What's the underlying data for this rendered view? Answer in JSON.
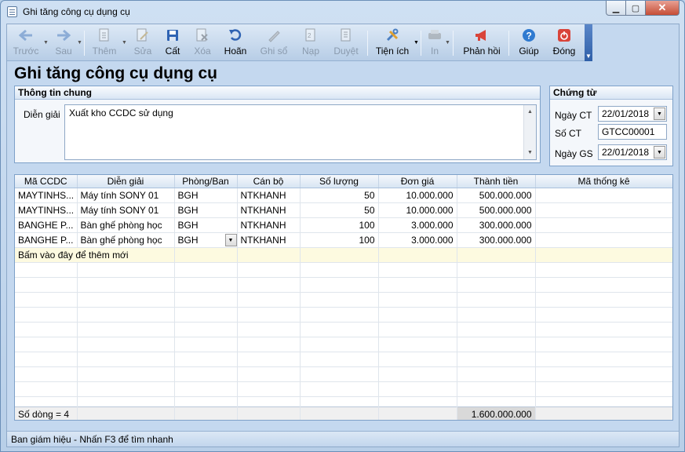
{
  "window": {
    "title": "Ghi tăng công cụ dụng cụ"
  },
  "toolbar": {
    "back": "Trước",
    "next": "Sau",
    "add": "Thêm",
    "edit": "Sửa",
    "save": "Cất",
    "delete": "Xóa",
    "undo": "Hoãn",
    "post": "Ghi sổ",
    "load": "Nạp",
    "approve": "Duyệt",
    "utilities": "Tiện ích",
    "print": "In",
    "feedback": "Phản hồi",
    "help": "Giúp",
    "close": "Đóng"
  },
  "page_title": "Ghi tăng công cụ dụng cụ",
  "general_info": {
    "header": "Thông tin chung",
    "desc_label": "Diễn giải",
    "desc_value": "Xuất kho CCDC sử dụng"
  },
  "voucher": {
    "header": "Chứng từ",
    "date_label": "Ngày CT",
    "date_value": "22/01/2018",
    "number_label": "Số CT",
    "number_value": "GTCC00001",
    "post_date_label": "Ngày GS",
    "post_date_value": "22/01/2018"
  },
  "grid": {
    "columns": [
      "Mã CCDC",
      "Diễn giải",
      "Phòng/Ban",
      "Cán bộ",
      "Số lượng",
      "Đơn giá",
      "Thành tiền",
      "Mã thống kê"
    ],
    "rows": [
      [
        "MAYTINHS...",
        "Máy tính SONY 01",
        "BGH",
        "NTKHANH",
        "50",
        "10.000.000",
        "500.000.000",
        ""
      ],
      [
        "MAYTINHS...",
        "Máy tính SONY 01",
        "BGH",
        "NTKHANH",
        "50",
        "10.000.000",
        "500.000.000",
        ""
      ],
      [
        "BANGHE P...",
        "Bàn ghế phòng học",
        "BGH",
        "NTKHANH",
        "100",
        "3.000.000",
        "300.000.000",
        ""
      ],
      [
        "BANGHE P...",
        "Bàn ghế phòng học",
        "BGH",
        "NTKHANH",
        "100",
        "3.000.000",
        "300.000.000",
        ""
      ]
    ],
    "new_row_hint": "Bấm vào đây để thêm mới",
    "row_count": "Số dòng = 4",
    "total": "1.600.000.000"
  },
  "status": {
    "text": "Ban giám hiệu - Nhấn F3 để tìm nhanh"
  }
}
